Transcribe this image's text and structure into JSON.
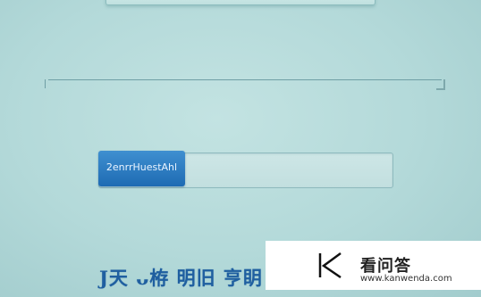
{
  "form": {
    "action_button_label": "2enrrHuestAhl"
  },
  "footer": {
    "text": "J天 ᴗ栫 明旧 亨眀 ᴗ栫 帞丰"
  },
  "watermark": {
    "brand": "看问答",
    "url": "www.kanwenda.com"
  }
}
